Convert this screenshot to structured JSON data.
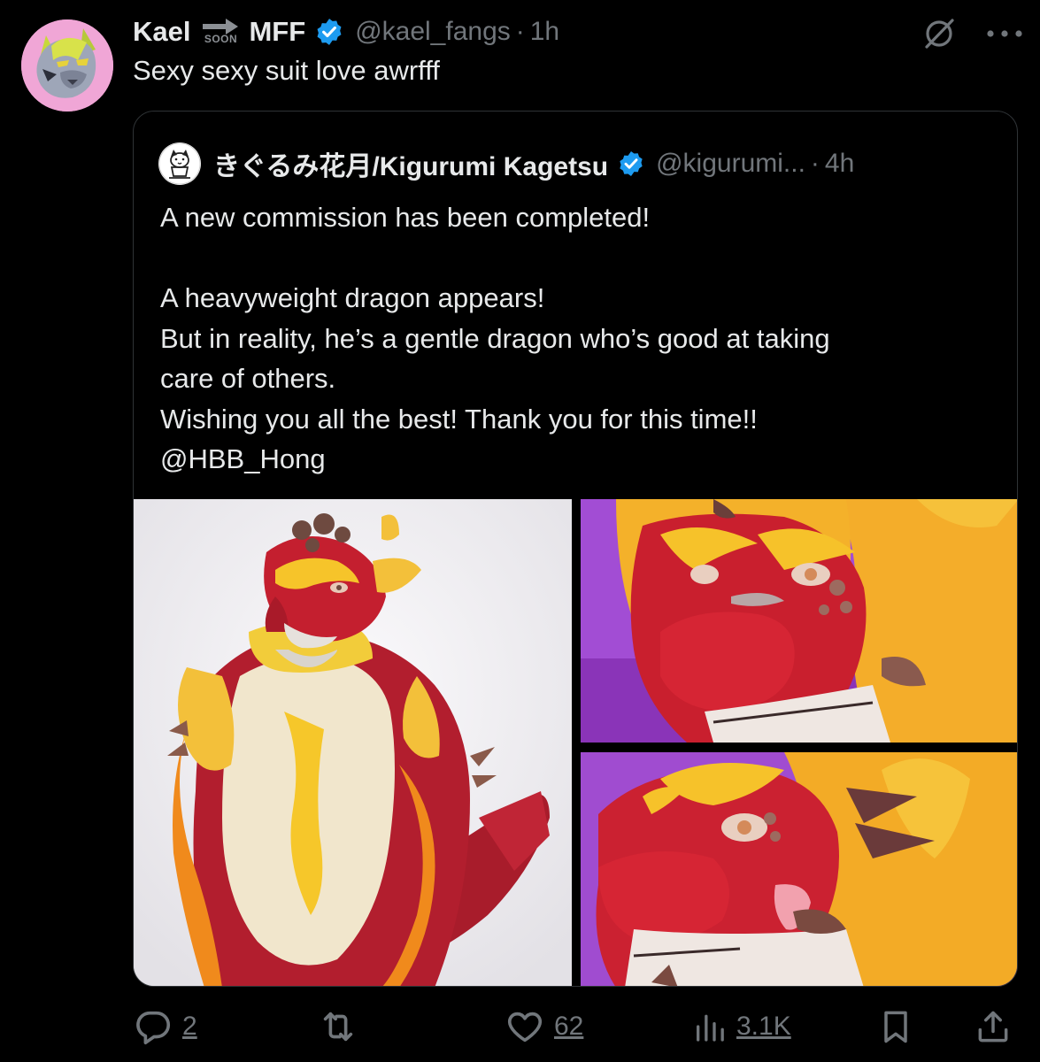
{
  "post": {
    "author_name": "Kael",
    "badge_label": "SOON",
    "author_name_suffix": "MFF",
    "handle": "@kael_fangs",
    "separator": "·",
    "time": "1h",
    "text": "Sexy sexy suit love awrfff",
    "avatar_icon": "wolf-avatar-icon"
  },
  "top_icons": [
    "grok-icon",
    "more-icon"
  ],
  "more_label": "•••",
  "quoted": {
    "author_name": "きぐるみ花月/Kigurumi Kagetsu",
    "handle": "@kigurumi...",
    "separator": "·",
    "time": "4h",
    "lines": [
      "A new commission has been completed!",
      "",
      "A heavyweight dragon appears!",
      "But in reality, he’s a gentle dragon who’s good at taking",
      "care of others.",
      "Wishing you all the best! Thank you for this time!!",
      "@HBB_Hong"
    ]
  },
  "actions": {
    "replies": "2",
    "likes": "62",
    "views": "3.1K"
  },
  "colors": {
    "background": "#000000",
    "text": "#e7e9ea",
    "secondary": "#71767b",
    "verified": "#1d9bf0",
    "border": "#2f3336"
  }
}
